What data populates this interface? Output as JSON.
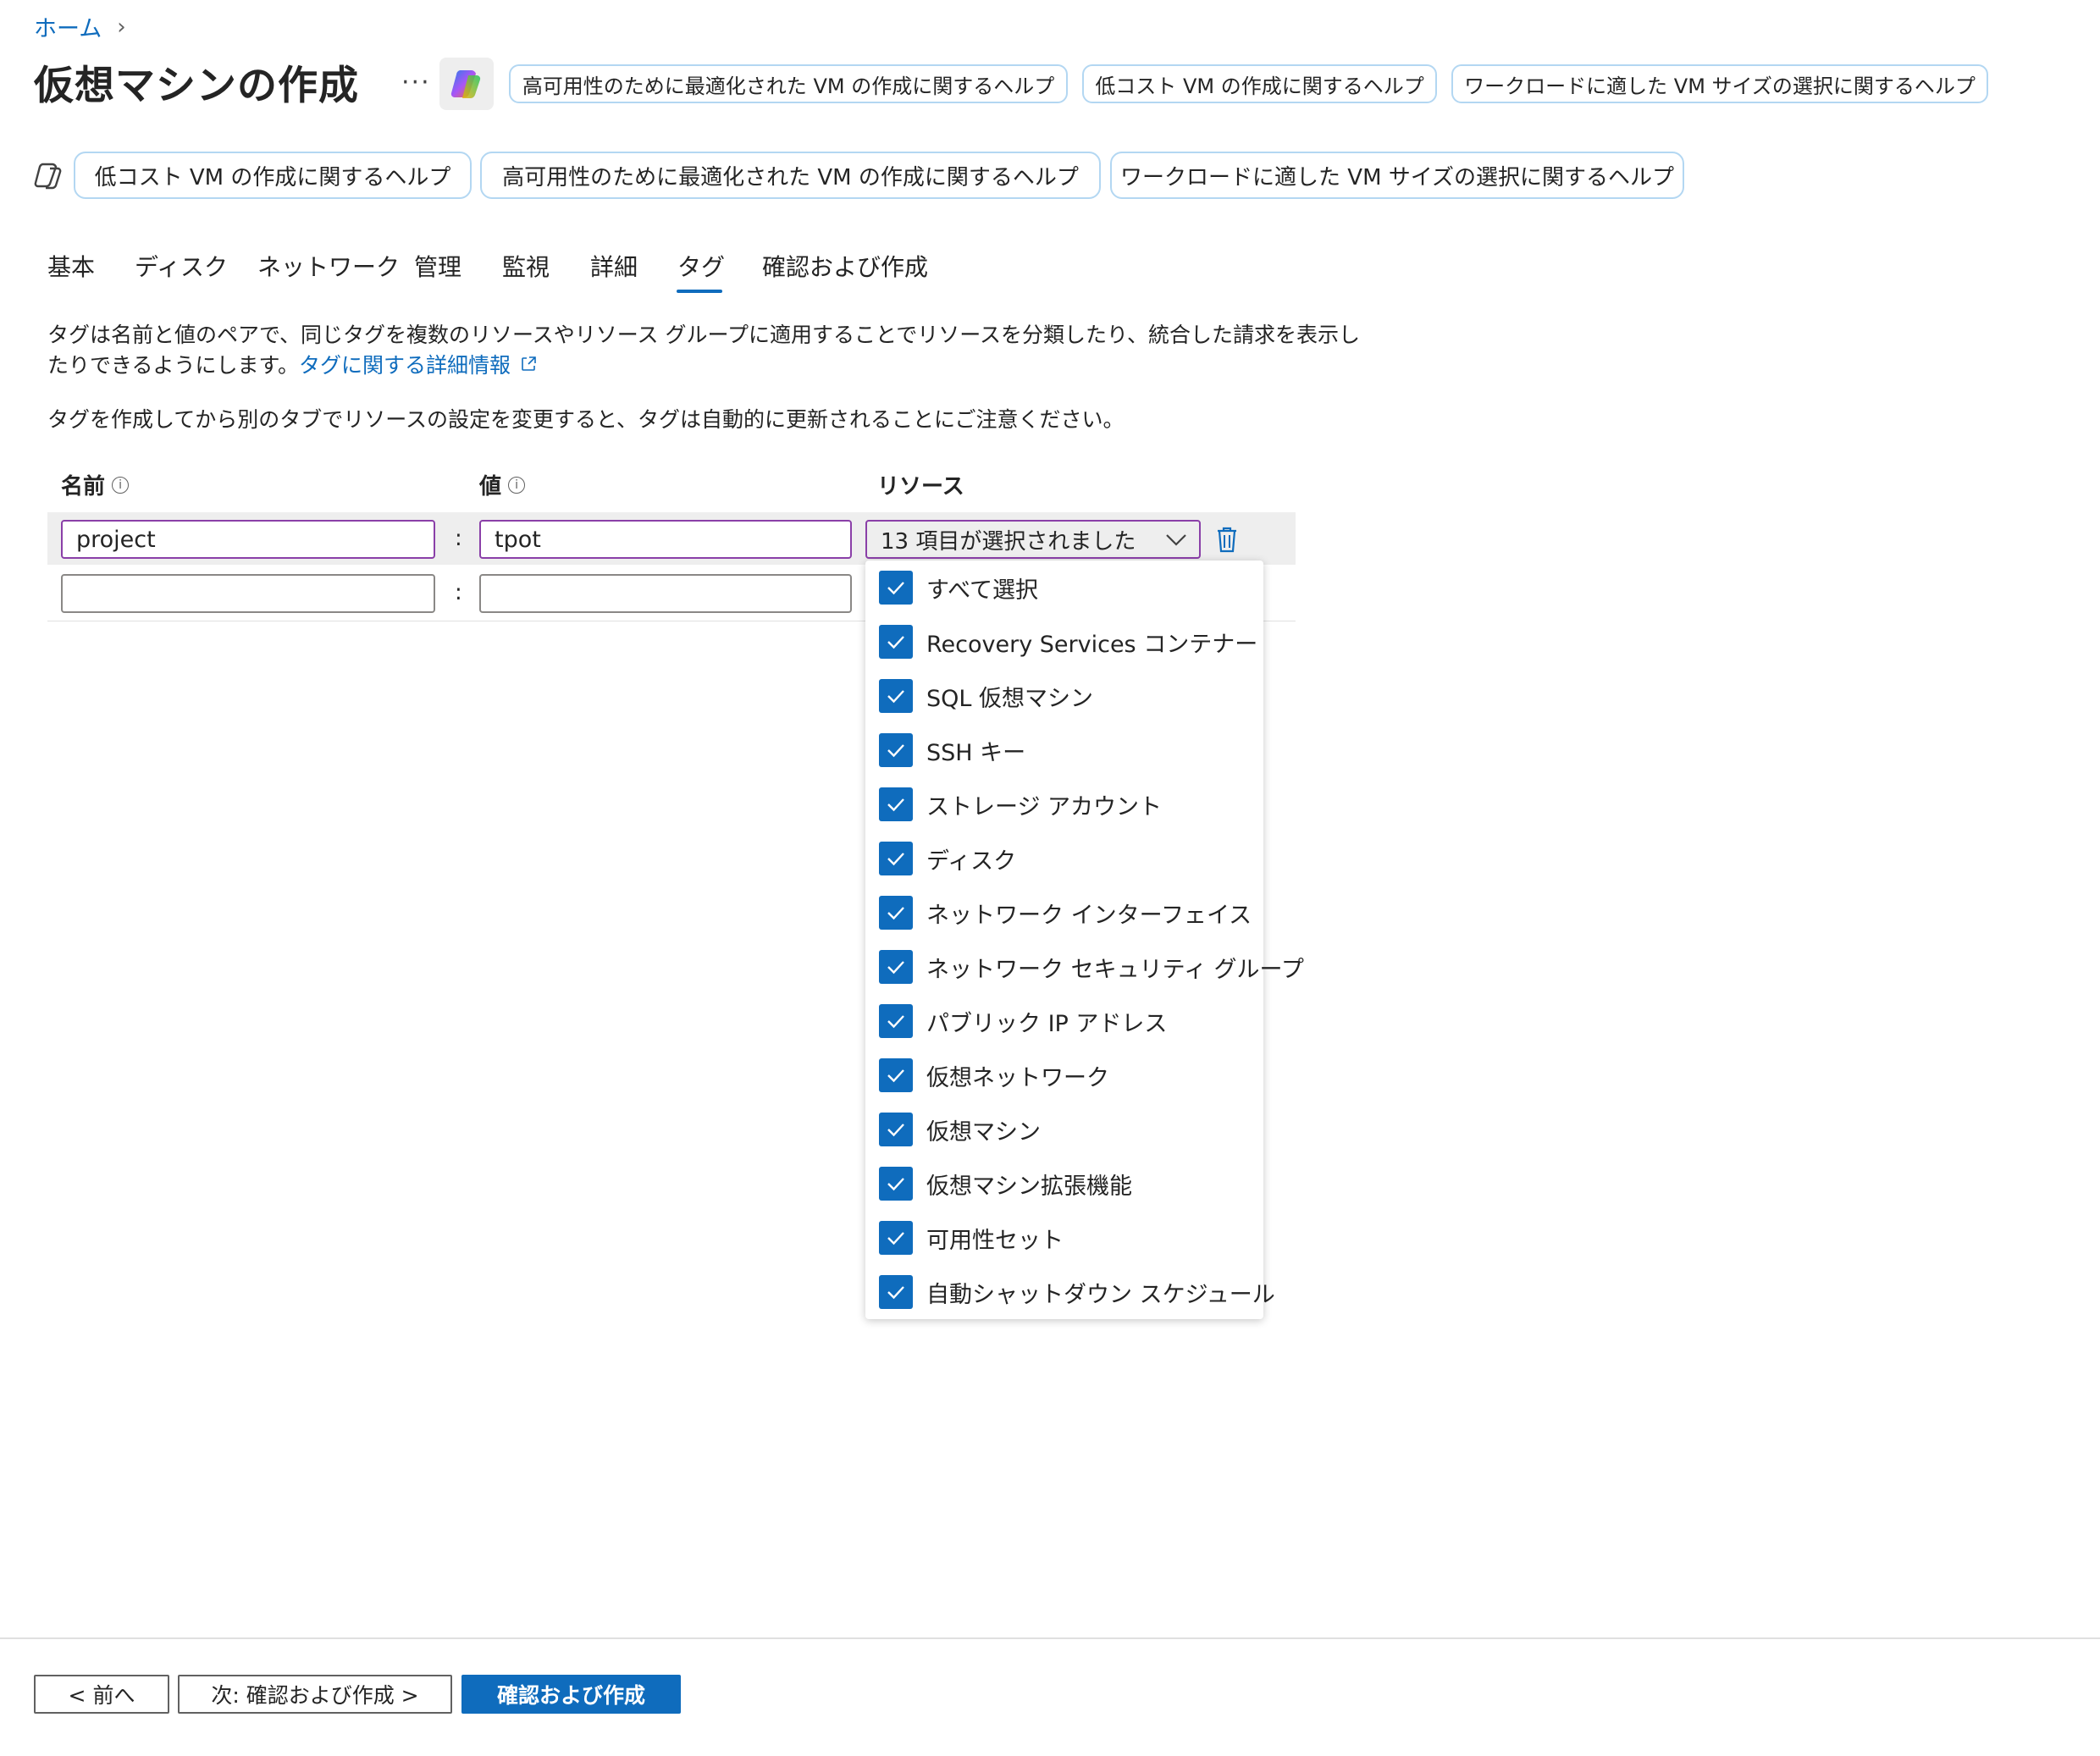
{
  "breadcrumb": {
    "home": "ホーム",
    "separator": "›"
  },
  "header": {
    "title": "仮想マシンの作成",
    "more": "···"
  },
  "top_suggestions": [
    "高可用性のために最適化された VM の作成に関するヘルプ",
    "低コスト VM の作成に関するヘルプ",
    "ワークロードに適した VM サイズの選択に関するヘルプ"
  ],
  "copilot_suggestions": [
    "低コスト VM の作成に関するヘルプ",
    "高可用性のために最適化された VM の作成に関するヘルプ",
    "ワークロードに適した VM サイズの選択に関するヘルプ"
  ],
  "tabs": [
    {
      "label": "基本"
    },
    {
      "label": "ディスク"
    },
    {
      "label": "ネットワーク"
    },
    {
      "label": "管理"
    },
    {
      "label": "監視"
    },
    {
      "label": "詳細"
    },
    {
      "label": "タグ",
      "active": true
    },
    {
      "label": "確認および作成"
    }
  ],
  "description": {
    "line1": "タグは名前と値のペアで、同じタグを複数のリソースやリソース グループに適用することでリソースを分類したり、統合した請求を表示し",
    "line2": "たりできるようにします。",
    "link": "タグに関する詳細情報",
    "note": "タグを作成してから別のタブでリソースの設定を変更すると、タグは自動的に更新されることにご注意ください。"
  },
  "table": {
    "headers": {
      "name": "名前",
      "value": "値",
      "resource": "リソース"
    },
    "rows": [
      {
        "name": "project",
        "value": "tpot",
        "resource": "13 項目が選択されました"
      },
      {
        "name": "",
        "value": ""
      }
    ],
    "separator": ":"
  },
  "resource_options": [
    "すべて選択",
    "Recovery Services コンテナー",
    "SQL 仮想マシン",
    "SSH キー",
    "ストレージ アカウント",
    "ディスク",
    "ネットワーク インターフェイス",
    "ネットワーク セキュリティ グループ",
    "パブリック IP アドレス",
    "仮想ネットワーク",
    "仮想マシン",
    "仮想マシン拡張機能",
    "可用性セット",
    "自動シャットダウン スケジュール"
  ],
  "footer": {
    "prev": "< 前へ",
    "next": "次: 確認および作成 >",
    "create": "確認および作成"
  },
  "colors": {
    "accent": "#0f6cbd",
    "focus_border": "#8a3fa8"
  },
  "icons": {
    "copilot": "copilot-icon",
    "external": "external-link-icon",
    "info": "info-icon",
    "trash": "trash-icon",
    "check": "checkmark-icon",
    "chevron": "chevron-down-icon"
  }
}
